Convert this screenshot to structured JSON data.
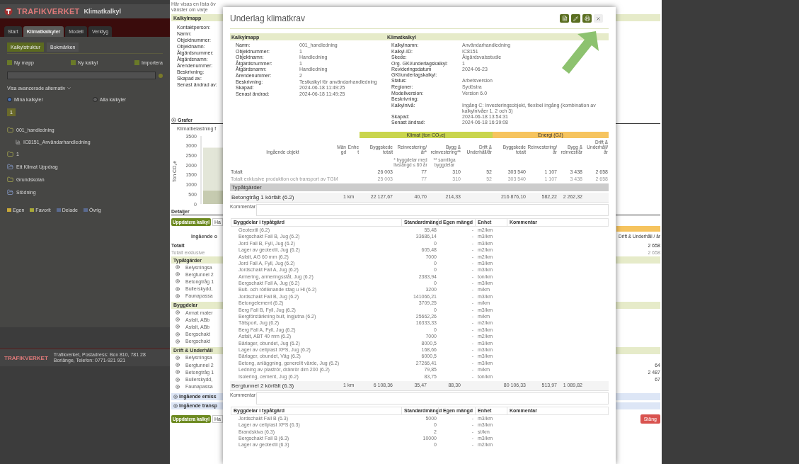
{
  "background_app": {
    "brand": "TRAFIKVERKET",
    "app_title": "Klimatkalkyl",
    "tabs": [
      {
        "label": "Start",
        "selected": false
      },
      {
        "label": "Klimatkalkyler",
        "selected": true
      },
      {
        "label": "Modell",
        "selected": false
      },
      {
        "label": "Verktyg",
        "selected": false
      }
    ],
    "subtabs": [
      {
        "label": "Kalkylstruktur",
        "selected": true
      },
      {
        "label": "Bokmärken",
        "selected": false
      }
    ],
    "actions": [
      "Ny mapp",
      "Ny kalkyl",
      "Importera"
    ],
    "advanced_link": "Visa avancerade alternativ",
    "radios": [
      {
        "label": "Mina kalkyler",
        "selected": true
      },
      {
        "label": "Alla kalkyler",
        "selected": false
      }
    ],
    "pages": [
      {
        "label": "1",
        "selected": true
      }
    ],
    "tree": [
      {
        "label": "001_handledning",
        "kind": "folder",
        "children": [
          {
            "label": "IC8151_Användarhandledning",
            "kind": "calc"
          }
        ]
      },
      {
        "label": "1",
        "kind": "folder"
      },
      {
        "label": "Ett Klimat Uppdrag",
        "kind": "shared"
      },
      {
        "label": "Grundskolan",
        "kind": "folder"
      },
      {
        "label": "Stödning",
        "kind": "shared"
      }
    ],
    "legend": [
      {
        "label": "Egen",
        "color": "#c8a838"
      },
      {
        "label": "Favorit",
        "color": "#a8a838"
      },
      {
        "label": "Delade",
        "color": "#5a6a90"
      },
      {
        "label": "Övrig",
        "color": "#5a6a90"
      }
    ],
    "footer": {
      "brand": "TRAFIKVERKET",
      "address": "Trafikverket, Postadress: Box 810, 781 28 Borlänge, Telefon: 0771-921 921"
    }
  },
  "details_page": {
    "intro": [
      "Här visas en lista öv",
      "vänster om varje"
    ],
    "folder_header": "Kalkylmapp",
    "folder_labels": [
      "Kontaktperson:",
      "Namn:",
      "Objektnummer:",
      "Objektnamn:",
      "Åtgärdsnummer:",
      "Åtgärdsnamn:",
      "Ärendenummer:",
      "Beskrivning:",
      "Skapad av:",
      "Senast ändrad av:"
    ],
    "graphs_heading": "Grafer",
    "chart_data": {
      "type": "bar",
      "title": "Klimatbelastning f",
      "ylabel": "Ton CO₂e",
      "ylim": [
        0,
        3500
      ],
      "yticks": [
        0,
        500,
        1000,
        1500,
        2000,
        2500,
        3000,
        3500
      ],
      "stacked": true,
      "series": [
        {
          "color": "#c6cbb0",
          "values": [
            700
          ]
        },
        {
          "color": "#e3e6d8",
          "values": [
            2200
          ]
        }
      ]
    },
    "details_heading": "Detaljer",
    "update_button": "Uppdatera kalkyl",
    "manage_button": "Ha",
    "objects_heading": "Ingående o",
    "du_heading": "Drift & Underhåll / år",
    "totals": [
      {
        "label": "Totalt",
        "value": "2 658",
        "kind": "total"
      },
      {
        "label": "Totalt exklusive",
        "value": "2 658",
        "kind": "sub"
      }
    ],
    "groups": [
      {
        "title": "Typåtgärder",
        "rows": [
          {
            "label": "Belysningsa"
          },
          {
            "label": "Bergtunnel 2"
          },
          {
            "label": "Betongtråg 1"
          },
          {
            "label": "Bullerskydd,"
          },
          {
            "label": "Faunapassa"
          }
        ]
      },
      {
        "title": "Byggdelar",
        "rows": [
          {
            "label": "Armat mater"
          },
          {
            "label": "Asfalt, ABb"
          },
          {
            "label": "Asfalt, ABb"
          },
          {
            "label": "Bergschakt"
          },
          {
            "label": "Bergschakt"
          }
        ]
      },
      {
        "title": "Drift & Underhåll",
        "rows": [
          {
            "label": "Belysningsa"
          },
          {
            "label": "Bergtunnel 2",
            "value": "64"
          },
          {
            "label": "Betongtråg 1",
            "value": "2 487"
          },
          {
            "label": "Bullerskydd,",
            "value": "67"
          },
          {
            "label": "Faunapassa"
          }
        ]
      }
    ],
    "expanders": [
      "Ingående emiss",
      "Ingående transp"
    ],
    "bottom_update_button": "Uppdatera kalkyl",
    "bottom_manage_button": "Ha",
    "close_button": "Stäng"
  },
  "modal": {
    "title": "Underlag klimatkrav",
    "toolbar": [
      {
        "kind": "document"
      },
      {
        "kind": "edit"
      },
      {
        "kind": "print"
      },
      {
        "kind": "close"
      }
    ],
    "section_headers": [
      "Kalkylmapp",
      "Klimatkalkyl"
    ],
    "folder_fields": [
      {
        "label": "Namn:",
        "value": "001_handledning"
      },
      {
        "label": "Objektnummer:",
        "value": "1"
      },
      {
        "label": "Objektnamn:",
        "value": "Handledning"
      },
      {
        "label": "Åtgärdsnummer:",
        "value": "1"
      },
      {
        "label": "Åtgärdsnamn:",
        "value": "Handledning"
      },
      {
        "label": "Ärendenummer:",
        "value": "2"
      },
      {
        "label": "Beskrivning:",
        "value": "Testkalkyl för användarhandledning"
      },
      {
        "label": "Skapad:",
        "value": "2024-06-18 11:49:25"
      },
      {
        "label": "Senast ändrad:",
        "value": "2024-06-18 11:49:25"
      }
    ],
    "calc_fields": [
      {
        "label": "Kalkylnamn:",
        "value": "Användarhandledning"
      },
      {
        "label": "Kalkyl-ID:",
        "value": "IC8151"
      },
      {
        "label": "Skede:",
        "value": "Åtgärdsvalsstudie"
      },
      {
        "label": "Org. GKI/underlagskalkyl:",
        "value": "1"
      },
      {
        "label": "Revideringsdatum GKI/underlagskalkyl:",
        "value": "2024-06-23"
      },
      {
        "label": "Status:",
        "value": "Arbetsversion"
      },
      {
        "label": "Regioner:",
        "value": "Sydöstra"
      },
      {
        "label": "Modellversion:",
        "value": "Version 6.0"
      },
      {
        "label": "Beskrivning:"
      },
      {
        "label": "Kalkylnivå:",
        "value": "Ingång C: Investeringsobjekt, flexibel ingång (kombination av kalkylnivåer 1, 2 och 3)"
      },
      {
        "label": "Skapad:",
        "value": "2024-06-18 13:54:31"
      },
      {
        "label": "Senast ändrad:",
        "value": "2024-06-18 16:39:08"
      }
    ],
    "summary": {
      "groups": [
        {
          "label": "Klimat (ton CO₂e)",
          "kind": "climate"
        },
        {
          "label": "Energi (GJ)",
          "kind": "energy"
        }
      ],
      "columns": [
        "Ingående objekt",
        "Mängd",
        "Enhet",
        "Byggskede totalt",
        "Reinvestering/år*",
        "Bygg & reinvestering**",
        "Drift & Underhåll/år",
        "Byggskede totalt",
        "Reinvestering/år",
        "Bygg & reinvest/år",
        "Drift & Underhåll/år"
      ],
      "notes": {
        "reinvestment": "* byggdelar med livslängd ≤ 60 år",
        "build_reinvest": "** samtliga byggdelar"
      },
      "rows": [
        {
          "label": "Totalt",
          "kind": "total",
          "climate": [
            "26 003",
            "77",
            "310",
            "52"
          ],
          "energy": [
            "303 540",
            "1 107",
            "3 438",
            "2 658"
          ]
        },
        {
          "label": "Totalt exklusive produktion och transport av TGM",
          "kind": "sub",
          "climate": [
            "25 003",
            "77",
            "310",
            "52"
          ],
          "energy": [
            "303 540",
            "1 107",
            "3 438",
            "2 658"
          ]
        }
      ]
    },
    "measures_heading": "Typåtgärder",
    "measures": [
      {
        "name": "Betongtråg 1 körfält (6.2)",
        "quantity": "1",
        "unit": "km",
        "climate": [
          "22 127,67",
          "40,70",
          "214,33"
        ],
        "energy": [
          "216 876,10",
          "582,22",
          "2 262,32"
        ],
        "comment_label": "Kommentar",
        "parts_columns": [
          "Byggdelar i typåtgärd",
          "Standardmängd",
          "Egen mängd",
          "Enhet",
          "Kommentar"
        ],
        "parts": [
          {
            "name": "Geotextil (6.2)",
            "standard": "55,48",
            "own": "-",
            "unit": "m2/km"
          },
          {
            "name": "Bergschakt Fall B, Jug (6.2)",
            "standard": "33686,14",
            "own": "-",
            "unit": "m3/km"
          },
          {
            "name": "Jord Fall B, Fyll, Jug (6.2)",
            "standard": "0",
            "own": "-",
            "unit": "m3/km"
          },
          {
            "name": "Lager av geotextil, Jug (6.2)",
            "standard": "605,48",
            "own": "-",
            "unit": "m2/km"
          },
          {
            "name": "Asfalt, AG 60 mm (6.2)",
            "standard": "7000",
            "own": "-",
            "unit": "m2/km"
          },
          {
            "name": "Jord Fall A, Fyll, Jug (6.2)",
            "standard": "0",
            "own": "-",
            "unit": "m3/km"
          },
          {
            "name": "Jordschakt Fall A, Jug (6.2)",
            "standard": "0",
            "own": "-",
            "unit": "m3/km"
          },
          {
            "name": "Armering, armeringsstål, Jug (6.2)",
            "standard": "2383,94",
            "own": "-",
            "unit": "ton/km"
          },
          {
            "name": "Bergschakt Fall A, Jug (6.2)",
            "standard": "0",
            "own": "-",
            "unit": "m3/km"
          },
          {
            "name": "Bult- och rörliknande stag u Hl (6.2)",
            "standard": "3200",
            "own": "-",
            "unit": "m/km"
          },
          {
            "name": "Jordschakt Fall B, Jug (6.2)",
            "standard": "141066,21",
            "own": "-",
            "unit": "m3/km"
          },
          {
            "name": "Betongelement (6.2)",
            "standard": "3709,25",
            "own": "-",
            "unit": "m/km"
          },
          {
            "name": "Berg Fall B, Fyll, Jug (6.2)",
            "standard": "0",
            "own": "-",
            "unit": "m3/km"
          },
          {
            "name": "Bergförstärkning bult, ingjutna (6.2)",
            "standard": "25662,26",
            "own": "-",
            "unit": "m/km"
          },
          {
            "name": "Tätsport, Jug (6.2)",
            "standard": "16333,33",
            "own": "-",
            "unit": "m2/km"
          },
          {
            "name": "Berg Fall A, Fyll, Jug (6.2)",
            "standard": "0",
            "own": "-",
            "unit": "m3/km"
          },
          {
            "name": "Asfalt, ABT 40 mm (6.2)",
            "standard": "7000",
            "own": "-",
            "unit": "m2/km"
          },
          {
            "name": "Bärlager, obundet, Jug (6.2)",
            "standard": "8000,5",
            "own": "-",
            "unit": "m3/km"
          },
          {
            "name": "Lager av cellplast XPS, Jug (6.2)",
            "standard": "168,66",
            "own": "-",
            "unit": "m3/km"
          },
          {
            "name": "Bärlager, obundet, Väg (6.2)",
            "standard": "6000,5",
            "own": "-",
            "unit": "m3/km"
          },
          {
            "name": "Betong, anläggning, generellt värde, Jug (6.2)",
            "standard": "27266,41",
            "own": "-",
            "unit": "m3/km"
          },
          {
            "name": "Ledning av plaströr, dränrör dim 200 (6.2)",
            "standard": "79,85",
            "own": "-",
            "unit": "m/km"
          },
          {
            "name": "Isolering, cement, Jug (6.2)",
            "standard": "83,75",
            "own": "-",
            "unit": "ton/km"
          }
        ]
      },
      {
        "name": "Bergtunnel 2 körfält (6.3)",
        "quantity": "1",
        "unit": "km",
        "climate": [
          "6 108,36",
          "35,47",
          "88,30"
        ],
        "energy": [
          "80 106,33",
          "513,97",
          "1 089,82"
        ],
        "comment_label": "Kommentar",
        "parts_columns": [
          "Byggdelar i typåtgärd",
          "Standardmängd",
          "Egen mängd",
          "Enhet",
          "Kommentar"
        ],
        "parts": [
          {
            "name": "Jordschakt Fall B (6.3)",
            "standard": "5000",
            "own": "-",
            "unit": "m3/km"
          },
          {
            "name": "Lager av cellplast XPS (6.3)",
            "standard": "0",
            "own": "-",
            "unit": "m3/km"
          },
          {
            "name": "Brandskiva (6.3)",
            "standard": "2",
            "own": "-",
            "unit": "st/km"
          },
          {
            "name": "Bergschakt Fall B (6.3)",
            "standard": "10000",
            "own": "-",
            "unit": "m3/km"
          },
          {
            "name": "Lager av geotextil (6.3)",
            "standard": "0",
            "own": "-",
            "unit": "m2/km"
          }
        ]
      }
    ]
  }
}
